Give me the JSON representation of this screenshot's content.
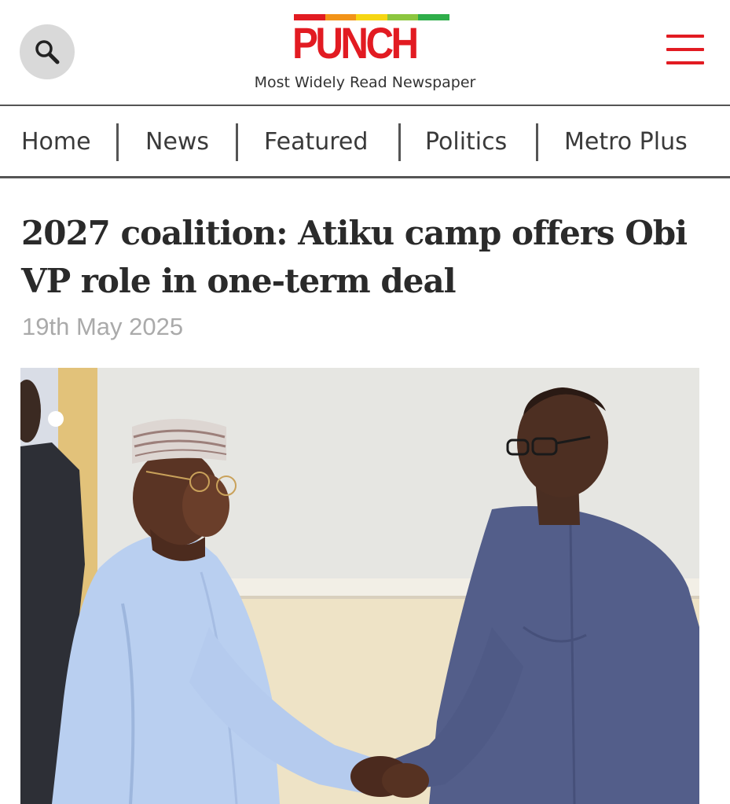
{
  "header": {
    "logo_text": "PUNCH",
    "tagline": "Most Widely Read Newspaper",
    "search_icon": "search-icon",
    "menu_icon": "hamburger-menu-icon",
    "brand_color": "#e21b22",
    "logo_stripe_colors": [
      "#e21b22",
      "#f29318",
      "#f6d613",
      "#8cc63f",
      "#2fae4a"
    ]
  },
  "nav": {
    "items": [
      {
        "label": "Home"
      },
      {
        "label": "News"
      },
      {
        "label": "Featured"
      },
      {
        "label": "Politics"
      },
      {
        "label": "Metro Plus"
      }
    ]
  },
  "article": {
    "headline": "2027 coalition: Atiku camp offers Obi VP role in one-term deal",
    "date": "19th May 2025"
  }
}
